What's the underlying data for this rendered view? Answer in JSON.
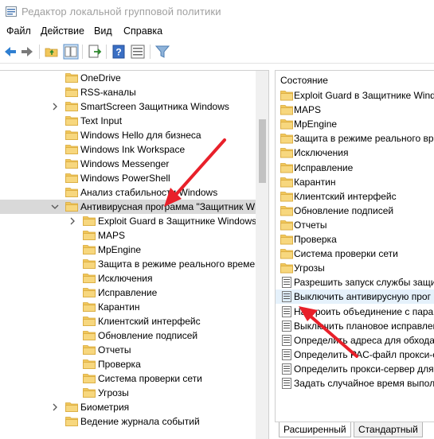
{
  "window": {
    "title": "Редактор локальной групповой политики"
  },
  "menu": {
    "items": [
      "Файл",
      "Действие",
      "Вид",
      "Справка"
    ]
  },
  "toolbar": {
    "buttons": [
      "back-icon",
      "forward-icon",
      "up-folder-icon",
      "show-hide-tree-icon",
      "export-list-icon",
      "help-icon",
      "properties-icon",
      "filter-icon"
    ]
  },
  "tree": {
    "items": [
      {
        "label": "OneDrive",
        "expander": false,
        "level": 0
      },
      {
        "label": "RSS-каналы",
        "expander": false,
        "level": 0
      },
      {
        "label": "SmartScreen Защитника Windows",
        "expander": true,
        "level": 0
      },
      {
        "label": "Text Input",
        "expander": false,
        "level": 0
      },
      {
        "label": "Windows Hello для бизнеса",
        "expander": false,
        "level": 0
      },
      {
        "label": "Windows Ink Workspace",
        "expander": false,
        "level": 0
      },
      {
        "label": "Windows Messenger",
        "expander": false,
        "level": 0
      },
      {
        "label": "Windows PowerShell",
        "expander": false,
        "level": 0
      },
      {
        "label": "Анализ стабильности Windows",
        "expander": false,
        "level": 0
      },
      {
        "label": "Антивирусная программа \"Защитник W",
        "expander": "open",
        "level": 0,
        "selected": true
      },
      {
        "label": "Exploit Guard в Защитнике Windows",
        "expander": true,
        "level": 1
      },
      {
        "label": "MAPS",
        "expander": false,
        "level": 1
      },
      {
        "label": "MpEngine",
        "expander": false,
        "level": 1
      },
      {
        "label": "Защита в режиме реального времен",
        "expander": false,
        "level": 1
      },
      {
        "label": "Исключения",
        "expander": false,
        "level": 1
      },
      {
        "label": "Исправление",
        "expander": false,
        "level": 1
      },
      {
        "label": "Карантин",
        "expander": false,
        "level": 1
      },
      {
        "label": "Клиентский интерфейс",
        "expander": false,
        "level": 1
      },
      {
        "label": "Обновление подписей",
        "expander": false,
        "level": 1
      },
      {
        "label": "Отчеты",
        "expander": false,
        "level": 1
      },
      {
        "label": "Проверка",
        "expander": false,
        "level": 1
      },
      {
        "label": "Система проверки сети",
        "expander": false,
        "level": 1
      },
      {
        "label": "Угрозы",
        "expander": false,
        "level": 1
      },
      {
        "label": "Биометрия",
        "expander": true,
        "level": 0
      },
      {
        "label": "Ведение журнала событий",
        "expander": false,
        "level": 0
      }
    ]
  },
  "list": {
    "header": "Состояние",
    "items": [
      {
        "label": "Exploit Guard в Защитнике Windo",
        "type": "folder"
      },
      {
        "label": "MAPS",
        "type": "folder"
      },
      {
        "label": "MpEngine",
        "type": "folder"
      },
      {
        "label": "Защита в режиме реального вре",
        "type": "folder"
      },
      {
        "label": "Исключения",
        "type": "folder"
      },
      {
        "label": "Исправление",
        "type": "folder"
      },
      {
        "label": "Карантин",
        "type": "folder"
      },
      {
        "label": "Клиентский интерфейс",
        "type": "folder"
      },
      {
        "label": "Обновление подписей",
        "type": "folder"
      },
      {
        "label": "Отчеты",
        "type": "folder"
      },
      {
        "label": "Проверка",
        "type": "folder"
      },
      {
        "label": "Система проверки сети",
        "type": "folder"
      },
      {
        "label": "Угрозы",
        "type": "folder"
      },
      {
        "label": "Разрешить запуск службы защи",
        "type": "policy"
      },
      {
        "label": "Выключить антивирусную прог",
        "type": "policy",
        "highlight": true
      },
      {
        "label": "Настроить объединение с парам",
        "type": "policy"
      },
      {
        "label": "Выключить плановое исправлен",
        "type": "policy"
      },
      {
        "label": "Определить адреса для обхода п",
        "type": "policy"
      },
      {
        "label": "Определить PAC-файл прокси-се",
        "type": "policy"
      },
      {
        "label": "Определить прокси-сервер для",
        "type": "policy"
      },
      {
        "label": "Задать случайное время выпол",
        "type": "policy"
      }
    ]
  },
  "tabs": {
    "extended": "Расширенный",
    "standard": "Стандартный"
  },
  "colors": {
    "folder": "#f1c75b",
    "folder_dark": "#d9a93a",
    "arrow": "#e8202a",
    "selected_bg": "#d9d9d9"
  }
}
